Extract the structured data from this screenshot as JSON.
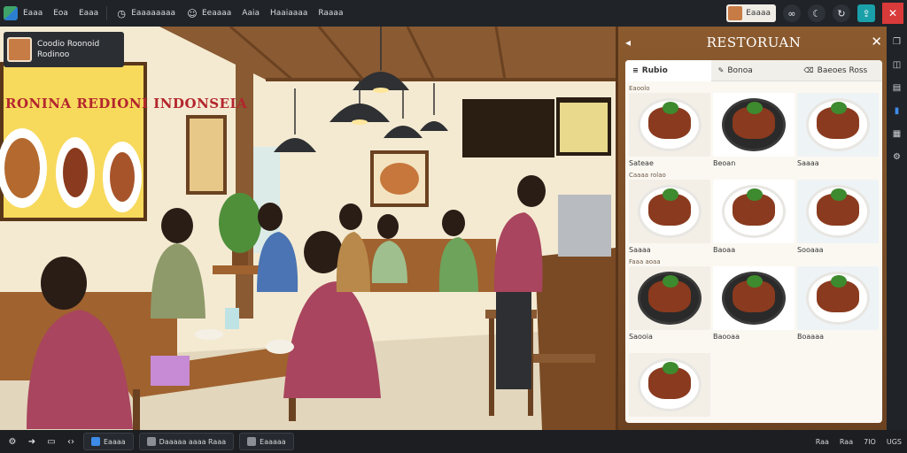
{
  "topbar": {
    "items": [
      {
        "label": "Eaaa",
        "icon": "grid-icon"
      },
      {
        "label": "Eoa",
        "icon": "folder-icon"
      },
      {
        "label": "Eaaa",
        "icon": "file-icon"
      },
      {
        "label": "Eaaaaaaaa",
        "icon": "clock-icon"
      },
      {
        "label": "Eeaaaa",
        "icon": "user-icon"
      },
      {
        "label": "Aaia",
        "icon": ""
      },
      {
        "label": "Haaiaaaa",
        "icon": ""
      },
      {
        "label": "Raaaa",
        "icon": ""
      }
    ],
    "user_label": "Eaaaa",
    "right_icons": [
      "link-icon",
      "moon-icon",
      "refresh-icon"
    ],
    "teal_icon": "share-icon",
    "close_icon": "close-icon"
  },
  "notification": {
    "line1": "Coodio Roonoid",
    "line2": "Rodinoo"
  },
  "scene": {
    "banner": "RONINA REDIONI INDONSEIA"
  },
  "menu_panel": {
    "title": "RESTORUAN",
    "tabs": [
      {
        "label": "Rubio",
        "icon": "list-icon"
      },
      {
        "label": "Bonoa",
        "icon": "bell-icon"
      },
      {
        "label": "Baeoes Ross",
        "icon": "tag-icon"
      }
    ],
    "items": [
      {
        "caption": "Eaoolo",
        "name": "Sateae",
        "dark": false
      },
      {
        "caption": "",
        "name": "Beoan",
        "dark": true
      },
      {
        "caption": "",
        "name": "Saaaa",
        "dark": false
      },
      {
        "caption": "Caaaa rolao",
        "name": "Saaaa",
        "dark": false
      },
      {
        "caption": "",
        "name": "Baoaa",
        "dark": false
      },
      {
        "caption": "",
        "name": "Sooaaa",
        "dark": false
      },
      {
        "caption": "Faaa aoaa",
        "name": "Saooia",
        "dark": true
      },
      {
        "caption": "",
        "name": "Baooaa",
        "dark": true
      },
      {
        "caption": "",
        "name": "Boaaaa",
        "dark": false
      },
      {
        "caption": "",
        "name": "",
        "dark": false
      }
    ]
  },
  "rail_icons": [
    "copy-icon",
    "layers-icon",
    "text-icon",
    "chart-icon",
    "stack-icon",
    "settings-icon"
  ],
  "taskbar": {
    "icons": [
      "gear-icon",
      "arrow-icon",
      "window-icon",
      "code-icon"
    ],
    "tasks": [
      "Eaaaa",
      "Daaaaa aaaa Raaa",
      "Eaaaaa"
    ],
    "right": [
      "Raa",
      "Raa",
      "7IO",
      "UGS"
    ]
  }
}
